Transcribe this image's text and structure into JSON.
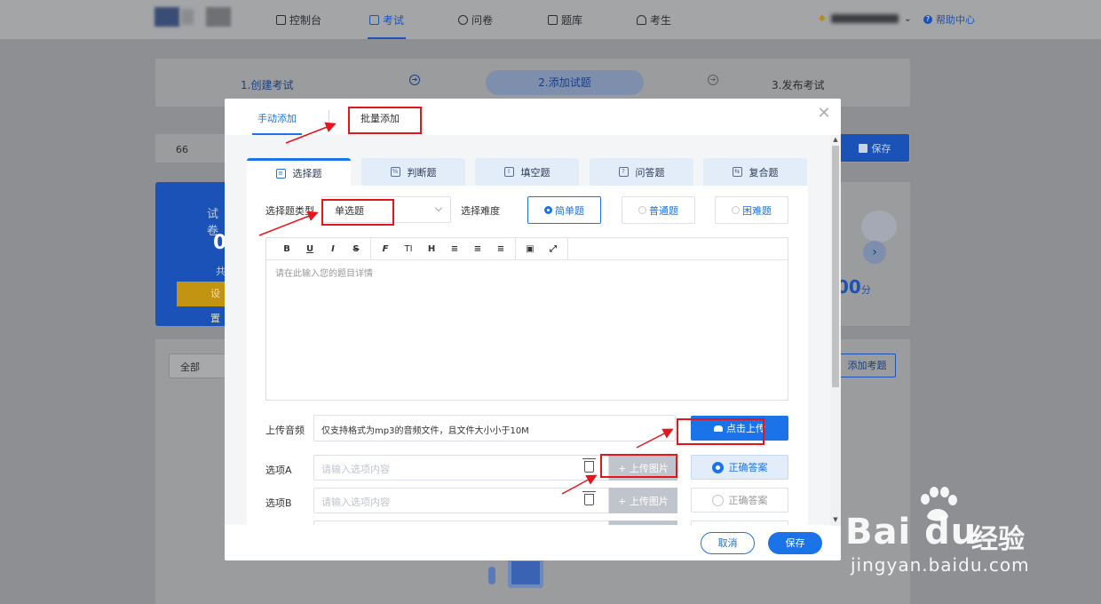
{
  "nav": {
    "items": [
      {
        "label": "控制台",
        "icon": "home-icon"
      },
      {
        "label": "考试",
        "icon": "calendar-icon",
        "active": true
      },
      {
        "label": "问卷",
        "icon": "questionnaire-icon"
      },
      {
        "label": "题库",
        "icon": "question-bank-icon"
      },
      {
        "label": "考生",
        "icon": "user-icon"
      }
    ],
    "help": "帮助中心"
  },
  "steps": {
    "step1": "1.创建考试",
    "step2": "2.添加试题",
    "step3": "3.发布考试"
  },
  "background": {
    "name_value": "66",
    "save_label": "保存",
    "left_card": {
      "title": "试卷",
      "count": "0",
      "sub": "共",
      "button": "设置"
    },
    "right_card": {
      "score": "00",
      "unit": "分"
    },
    "filter_all": "全部",
    "add_question": "添加考题"
  },
  "modal": {
    "tabs": {
      "manual": "手动添加",
      "batch": "批量添加"
    },
    "question_types": [
      {
        "label": "选择题",
        "icon": "list-icon"
      },
      {
        "label": "判断题",
        "icon": "percent-icon"
      },
      {
        "label": "填空题",
        "icon": "text-cursor-icon"
      },
      {
        "label": "问答题",
        "icon": "question-icon"
      },
      {
        "label": "复合题",
        "icon": "compound-icon"
      }
    ],
    "choice_type_label": "选择题类型",
    "choice_type_value": "单选题",
    "difficulty_label": "选择难度",
    "difficulties": [
      "简单题",
      "普通题",
      "困难题"
    ],
    "editor": {
      "toolbar": [
        "B",
        "U",
        "I",
        "S",
        "F",
        "TI",
        "H"
      ],
      "placeholder": "请在此输入您的题目详情"
    },
    "audio": {
      "label": "上传音频",
      "hint": "仅支持格式为mp3的音频文件，且文件大小小于10M",
      "button": "点击上传"
    },
    "options": [
      {
        "label": "选项A",
        "placeholder": "请输入选项内容",
        "upload": "+ 上传图片",
        "correct": "正确答案",
        "selected": true
      },
      {
        "label": "选项B",
        "placeholder": "请输入选项内容",
        "upload": "+ 上传图片",
        "correct": "正确答案",
        "selected": false
      }
    ],
    "footer": {
      "cancel": "取消",
      "save": "保存"
    }
  },
  "watermark": {
    "brand": "Bai du",
    "cn": "经验",
    "url": "jingyan.baidu.com"
  },
  "colors": {
    "primary": "#1a73e8",
    "annotation": "#e8141b"
  }
}
